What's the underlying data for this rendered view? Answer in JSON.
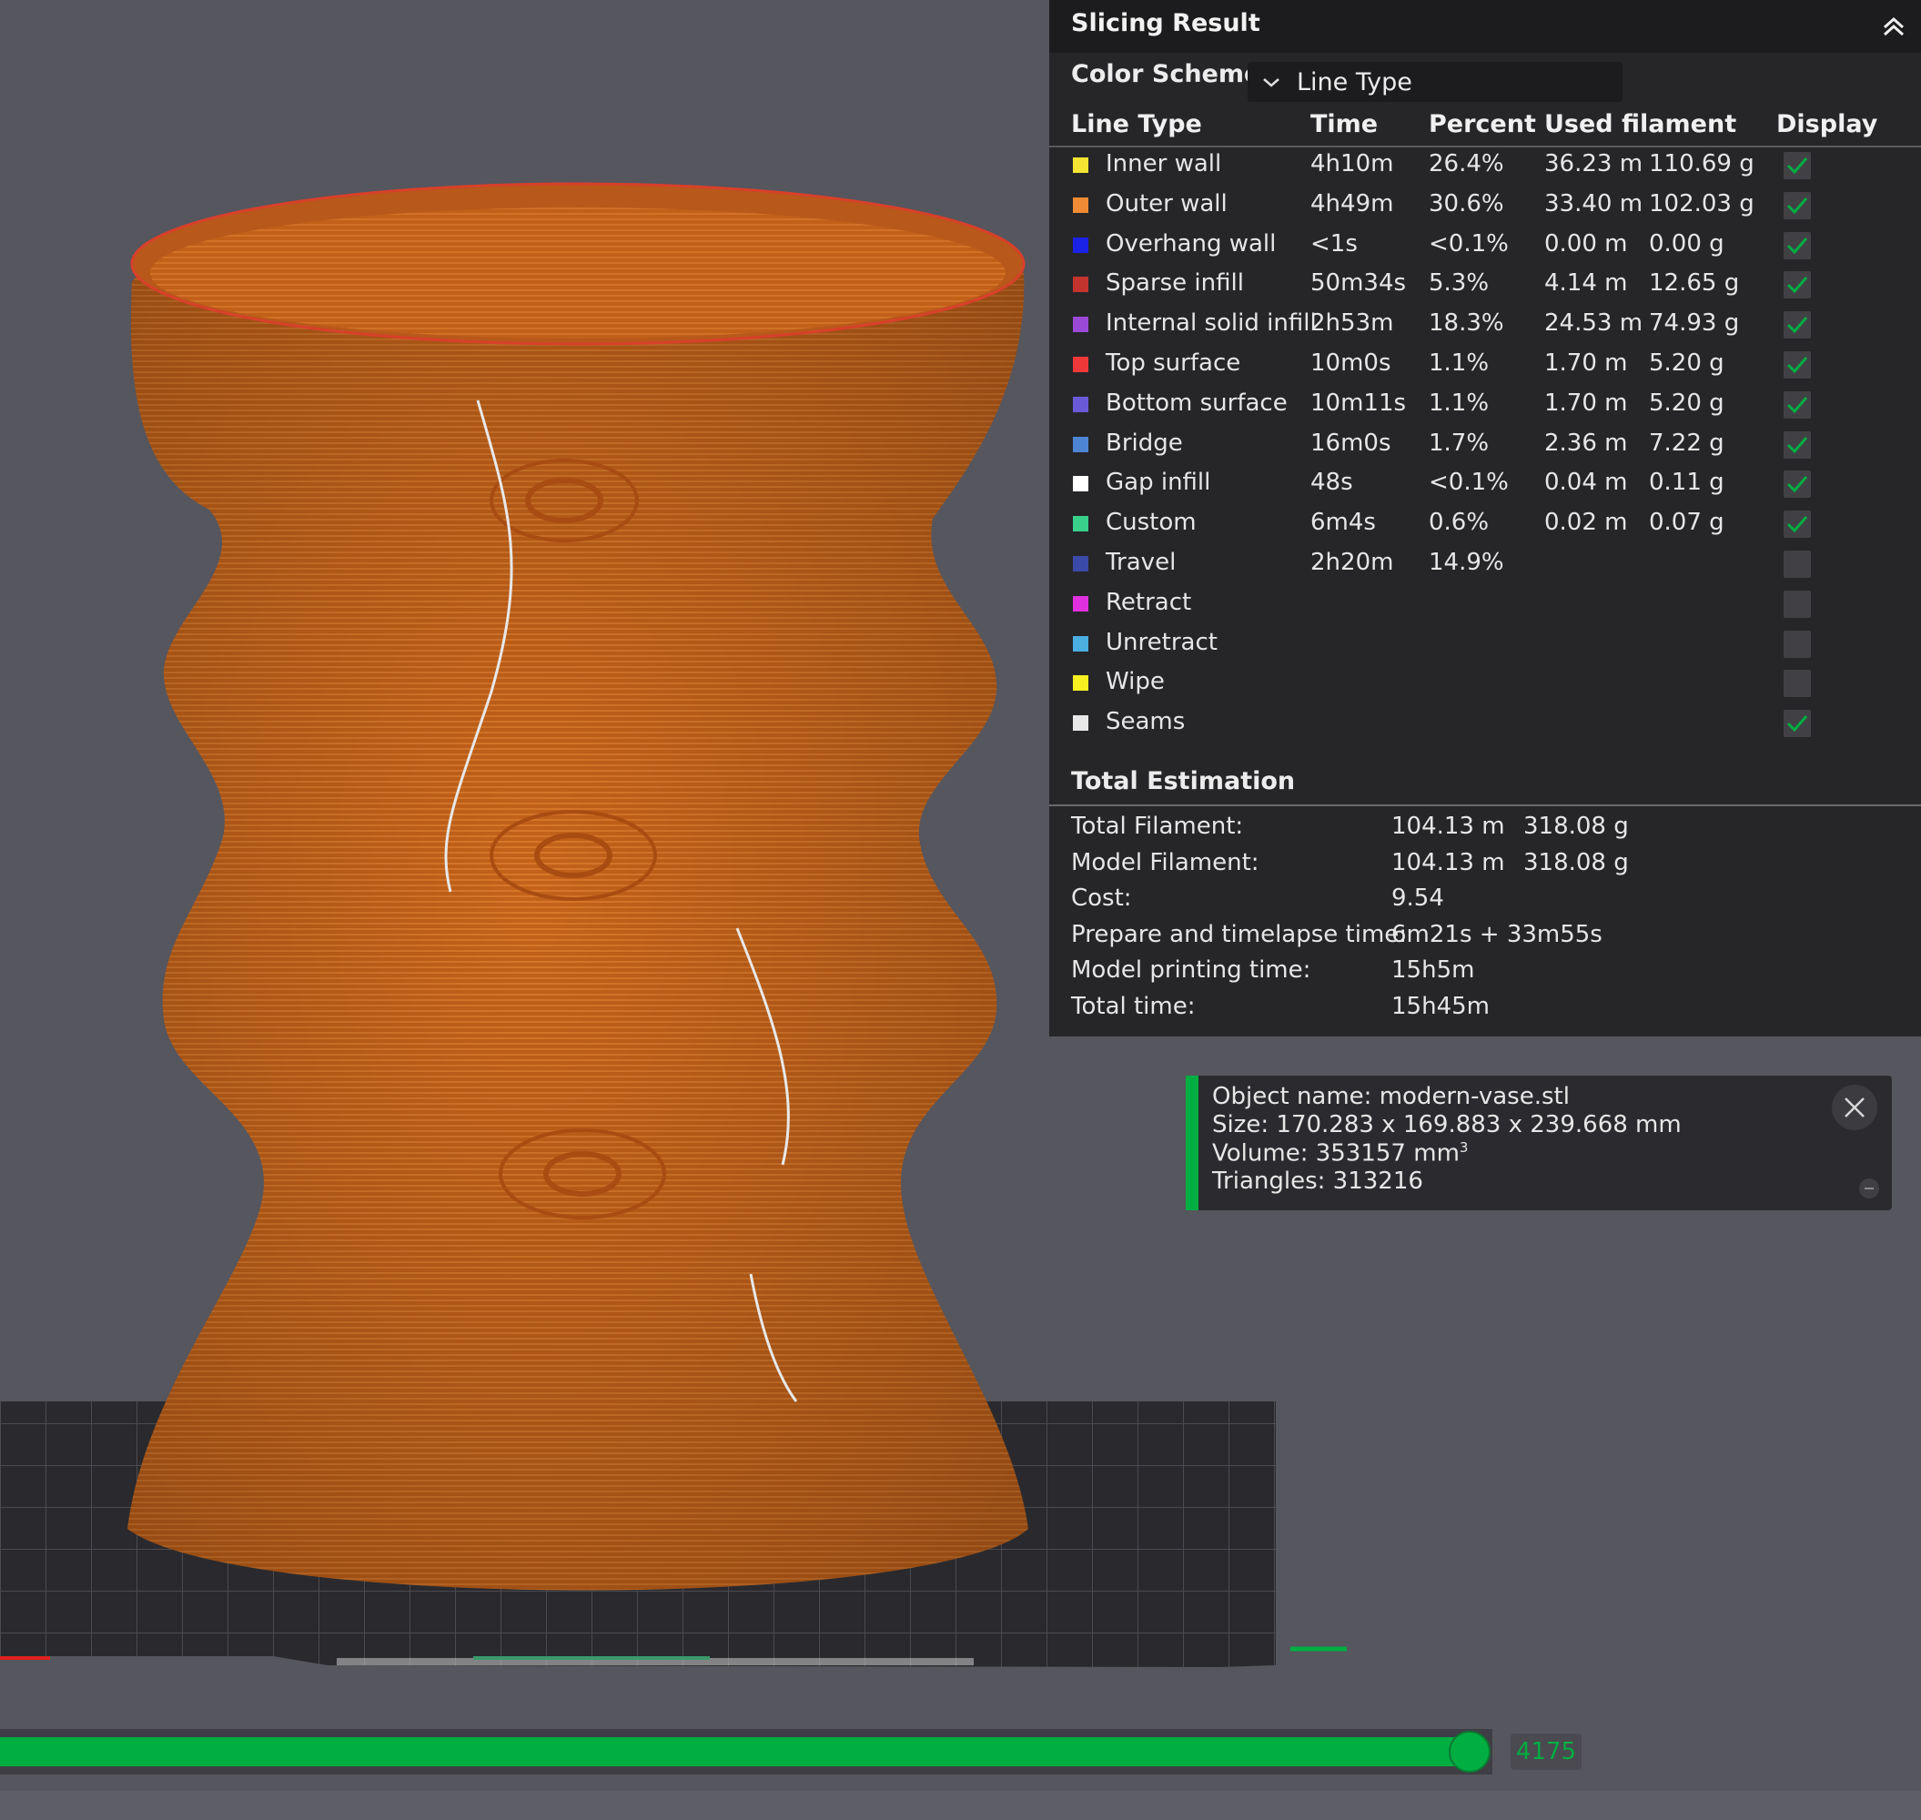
{
  "colors": {
    "accent": "#00ae42",
    "panel_bg": "#262629",
    "viewport_bg": "#56565e",
    "print_color": "#c8661c"
  },
  "panel": {
    "title": "Slicing Result",
    "collapse_icon": "double-chevron-up-icon",
    "color_scheme_label": "Color Scheme",
    "color_scheme_value": "Line Type",
    "headers": {
      "line_type": "Line Type",
      "time": "Time",
      "percent": "Percent",
      "used_filament": "Used filament",
      "display": "Display"
    },
    "rows": [
      {
        "name": "Inner wall",
        "color": "#f5e532",
        "time": "4h10m",
        "percent": "26.4%",
        "length": "36.23 m",
        "weight": "110.69 g",
        "display": true
      },
      {
        "name": "Outer wall",
        "color": "#f08a34",
        "time": "4h49m",
        "percent": "30.6%",
        "length": "33.40 m",
        "weight": "102.03 g",
        "display": true
      },
      {
        "name": "Overhang wall",
        "color": "#1a22e6",
        "time": "<1s",
        "percent": "<0.1%",
        "length": "0.00 m",
        "weight": "0.00 g",
        "display": true
      },
      {
        "name": "Sparse infill",
        "color": "#c4342e",
        "time": "50m34s",
        "percent": "5.3%",
        "length": "4.14 m",
        "weight": "12.65 g",
        "display": true
      },
      {
        "name": "Internal solid infill",
        "color": "#9a4ad6",
        "time": "2h53m",
        "percent": "18.3%",
        "length": "24.53 m",
        "weight": "74.93 g",
        "display": true
      },
      {
        "name": "Top surface",
        "color": "#f0383a",
        "time": "10m0s",
        "percent": "1.1%",
        "length": "1.70 m",
        "weight": "5.20 g",
        "display": true
      },
      {
        "name": "Bottom surface",
        "color": "#6a5ad8",
        "time": "10m11s",
        "percent": "1.1%",
        "length": "1.70 m",
        "weight": "5.20 g",
        "display": true
      },
      {
        "name": "Bridge",
        "color": "#4e84d4",
        "time": "16m0s",
        "percent": "1.7%",
        "length": "2.36 m",
        "weight": "7.22 g",
        "display": true
      },
      {
        "name": "Gap infill",
        "color": "#ffffff",
        "time": "48s",
        "percent": "<0.1%",
        "length": "0.04 m",
        "weight": "0.11 g",
        "display": true
      },
      {
        "name": "Custom",
        "color": "#38d08a",
        "time": "6m4s",
        "percent": "0.6%",
        "length": "0.02 m",
        "weight": "0.07 g",
        "display": true
      },
      {
        "name": "Travel",
        "color": "#3a4aa8",
        "time": "2h20m",
        "percent": "14.9%",
        "length": "",
        "weight": "",
        "display": false
      },
      {
        "name": "Retract",
        "color": "#e030e0",
        "time": "",
        "percent": "",
        "length": "",
        "weight": "",
        "display": false
      },
      {
        "name": "Unretract",
        "color": "#4aaee0",
        "time": "",
        "percent": "",
        "length": "",
        "weight": "",
        "display": false
      },
      {
        "name": "Wipe",
        "color": "#f7f020",
        "time": "",
        "percent": "",
        "length": "",
        "weight": "",
        "display": false
      },
      {
        "name": "Seams",
        "color": "#e8e8e8",
        "time": "",
        "percent": "",
        "length": "",
        "weight": "",
        "display": true
      }
    ],
    "total_title": "Total Estimation",
    "totals": [
      {
        "label": "Total Filament:",
        "v1": "104.13 m",
        "v2": "318.08 g"
      },
      {
        "label": "Model Filament:",
        "v1": "104.13 m",
        "v2": "318.08 g"
      },
      {
        "label": "Cost:",
        "v1": "9.54",
        "v2": ""
      },
      {
        "label": "Prepare and timelapse time:",
        "v1": "6m21s + 33m55s",
        "v2": ""
      },
      {
        "label": "Model printing time:",
        "v1": "15h5m",
        "v2": ""
      },
      {
        "label": "Total time:",
        "v1": "15h45m",
        "v2": ""
      }
    ]
  },
  "object_info": {
    "name_line": "Object name: modern-vase.stl",
    "size_line": "Size: 170.283 x 169.883 x 239.668 mm",
    "volume_text": "Volume: 353157 mm",
    "volume_sup": "3",
    "triangles_line": "Triangles: 313216",
    "close_icon": "close-icon",
    "minimize_icon": "minimize-icon"
  },
  "layer_slider": {
    "value": "4175",
    "fraction": 0.985
  }
}
